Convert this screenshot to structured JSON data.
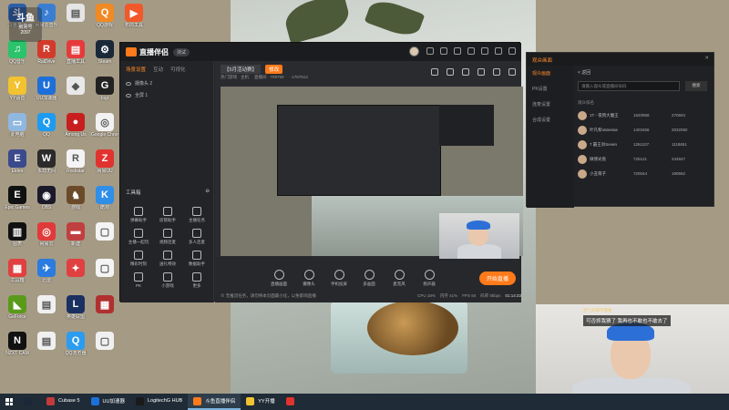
{
  "desktop": {
    "icons": [
      {
        "label": "斗鱼直播",
        "color": "#2d5ea8",
        "glyph": "斗",
        "col": 0,
        "row": 0
      },
      {
        "label": "网易云音乐",
        "color": "#3b7ed1",
        "glyph": "♪",
        "col": 1,
        "row": 0
      },
      {
        "label": "",
        "color": "#e5e5e5",
        "glyph": "▤",
        "col": 2,
        "row": 0
      },
      {
        "label": "QQ游戏",
        "color": "#f08a24",
        "glyph": "Q",
        "col": 3,
        "row": 0
      },
      {
        "label": "布局工具",
        "color": "#f1592a",
        "glyph": "▶",
        "col": 4,
        "row": 0
      },
      {
        "label": "QQ音乐",
        "color": "#2bc36b",
        "glyph": "♫",
        "col": 0,
        "row": 1
      },
      {
        "label": "RaiDrive",
        "color": "#d23b2b",
        "glyph": "R",
        "col": 1,
        "row": 1
      },
      {
        "label": "直播工具",
        "color": "#e63b3b",
        "glyph": "▤",
        "col": 2,
        "row": 1
      },
      {
        "label": "Steam",
        "color": "#1b2838",
        "glyph": "⚙",
        "col": 3,
        "row": 1
      },
      {
        "label": "YY语音",
        "color": "#f2c230",
        "glyph": "Y",
        "col": 0,
        "row": 2
      },
      {
        "label": "UU加速器",
        "color": "#1e6fd9",
        "glyph": "U",
        "col": 1,
        "row": 2
      },
      {
        "label": "",
        "color": "#e8e8e8",
        "glyph": "◆",
        "col": 2,
        "row": 2
      },
      {
        "label": "logi",
        "color": "#222222",
        "glyph": "G",
        "col": 3,
        "row": 2
      },
      {
        "label": "此电脑",
        "color": "#8fb7e0",
        "glyph": "▭",
        "col": 0,
        "row": 3
      },
      {
        "label": "QQ",
        "color": "#1d9bf0",
        "glyph": "Q",
        "col": 1,
        "row": 3
      },
      {
        "label": "Among Us",
        "color": "#c81e1e",
        "glyph": "●",
        "col": 2,
        "row": 3
      },
      {
        "label": "Google Chrome",
        "color": "#f2f2f2",
        "glyph": "◎",
        "col": 3,
        "row": 3
      },
      {
        "label": "Elden",
        "color": "#3a4a8c",
        "glyph": "E",
        "col": 0,
        "row": 4
      },
      {
        "label": "永劫无间",
        "color": "#2b2b2b",
        "glyph": "W",
        "col": 1,
        "row": 4
      },
      {
        "label": "Rockstar",
        "color": "#f4f4f4",
        "glyph": "R",
        "col": 2,
        "row": 4
      },
      {
        "label": "网易UU",
        "color": "#e0332f",
        "glyph": "Z",
        "col": 3,
        "row": 4
      },
      {
        "label": "Epic Games",
        "color": "#111111",
        "glyph": "E",
        "col": 0,
        "row": 5
      },
      {
        "label": "OBS",
        "color": "#1a1a2a",
        "glyph": "◉",
        "col": 1,
        "row": 5
      },
      {
        "label": "游戏",
        "color": "#6b4a2a",
        "glyph": "♞",
        "col": 2,
        "row": 5
      },
      {
        "label": "酷狗",
        "color": "#2f8ee8",
        "glyph": "K",
        "col": 3,
        "row": 5
      },
      {
        "label": "图表",
        "color": "#111111",
        "glyph": "▥",
        "col": 0,
        "row": 6
      },
      {
        "label": "网易云",
        "color": "#e03a3a",
        "glyph": "◎",
        "col": 1,
        "row": 6
      },
      {
        "label": "新建",
        "color": "#c04040",
        "glyph": "▬",
        "col": 2,
        "row": 6
      },
      {
        "label": "",
        "color": "#f4f4f4",
        "glyph": "▢",
        "col": 3,
        "row": 6
      },
      {
        "label": "工具箱",
        "color": "#e04040",
        "glyph": "▦",
        "col": 0,
        "row": 7
      },
      {
        "label": "迅雷",
        "color": "#2c7be0",
        "glyph": "✈",
        "col": 1,
        "row": 7
      },
      {
        "label": "",
        "color": "#e04040",
        "glyph": "✦",
        "col": 2,
        "row": 7
      },
      {
        "label": "",
        "color": "#f4f4f4",
        "glyph": "▢",
        "col": 3,
        "row": 7
      },
      {
        "label": "GeForce",
        "color": "#5a9a1a",
        "glyph": "◣",
        "col": 0,
        "row": 8
      },
      {
        "label": "",
        "color": "#f0f0f0",
        "glyph": "▤",
        "col": 1,
        "row": 8
      },
      {
        "label": "英雄联盟",
        "color": "#1a3060",
        "glyph": "L",
        "col": 2,
        "row": 8
      },
      {
        "label": "",
        "color": "#b03030",
        "glyph": "▦",
        "col": 3,
        "row": 8
      },
      {
        "label": "NZXT CAM",
        "color": "#111111",
        "glyph": "N",
        "col": 0,
        "row": 9
      },
      {
        "label": "",
        "color": "#f0f0f0",
        "glyph": "▤",
        "col": 1,
        "row": 9
      },
      {
        "label": "QQ浏览器",
        "color": "#2b9cf0",
        "glyph": "Q",
        "col": 2,
        "row": 9
      },
      {
        "label": "",
        "color": "#f0f0f0",
        "glyph": "▢",
        "col": 3,
        "row": 9
      }
    ],
    "overlay": {
      "logo": "斗鱼",
      "sub": "房间号",
      "room": "2097"
    }
  },
  "app": {
    "name": "直播伴侣",
    "tag": "测试",
    "left_tabs": [
      "场景设置",
      "互动",
      "可视化"
    ],
    "scenes": [
      "摄像头 2",
      "全屏 1"
    ],
    "tools_title": "工具箱",
    "tools": [
      "弹幕助手",
      "房管助手",
      "主播任务",
      "主播一起玩",
      "视频连麦",
      "多人连麦",
      "精彩时刻",
      "送礼特效",
      "数据助手",
      "PK",
      "小游戏",
      "更多"
    ],
    "room_title": "【5月活动赛】",
    "room_btn": "修改",
    "info": [
      "热门游戏 · 主机",
      "直播间 · 709750",
      "· 1767513"
    ],
    "bottom_controls": [
      "直播画面",
      "摄像头",
      "手机投屏",
      "多画面",
      "麦克风",
      "扬声器"
    ],
    "start_label": "开始直播",
    "status_left": "⊘ 无推流任务，请勿将本页面最小化，以免影响直播",
    "status_stats": [
      "CPU 18%",
      "内存 41%",
      "FPS 60",
      "码率 0kbps"
    ],
    "time": "01:14:33"
  },
  "dialog": {
    "title": "观众画面",
    "sidebar": [
      "观众画面",
      "PK设置",
      "连麦设置",
      "合成设置"
    ],
    "back": "< 返回",
    "search_placeholder": "请输入观众或直播间号码",
    "search_btn": "搜索",
    "rank_head": "观众排名",
    "rows": [
      {
        "name": "1T - 夜鸦大魔王",
        "v1": "1620958",
        "v2": "270604"
      },
      {
        "name": "叶凡和Vanessa",
        "v1": "1403456",
        "v2": "2032082"
      },
      {
        "name": "7 霸王剑Seven",
        "v1": "1261107",
        "v2": "1118651"
      },
      {
        "name": "微博光盘",
        "v1": "725121",
        "v2": "244947"
      },
      {
        "name": "小丑萌子",
        "v1": "720044",
        "v2": "190652"
      }
    ]
  },
  "cam2": {
    "danmu_user": "空气刘海不需要",
    "danmu": "可否抓我猜了 我再也不敢也不敢去了"
  },
  "taskbar": {
    "items": [
      {
        "label": "",
        "color": "#1b2838"
      },
      {
        "label": "Cubase 5",
        "color": "#c23b3b"
      },
      {
        "label": "UU加速器",
        "color": "#1e6fd9"
      },
      {
        "label": "LogitechG HUB",
        "color": "#1a1a1a"
      },
      {
        "label": "斗鱼直播伴侣",
        "color": "#ff7a1a"
      },
      {
        "label": "YY开播",
        "color": "#f2c230"
      },
      {
        "label": "",
        "color": "#e0332f"
      }
    ],
    "active_index": 4
  }
}
